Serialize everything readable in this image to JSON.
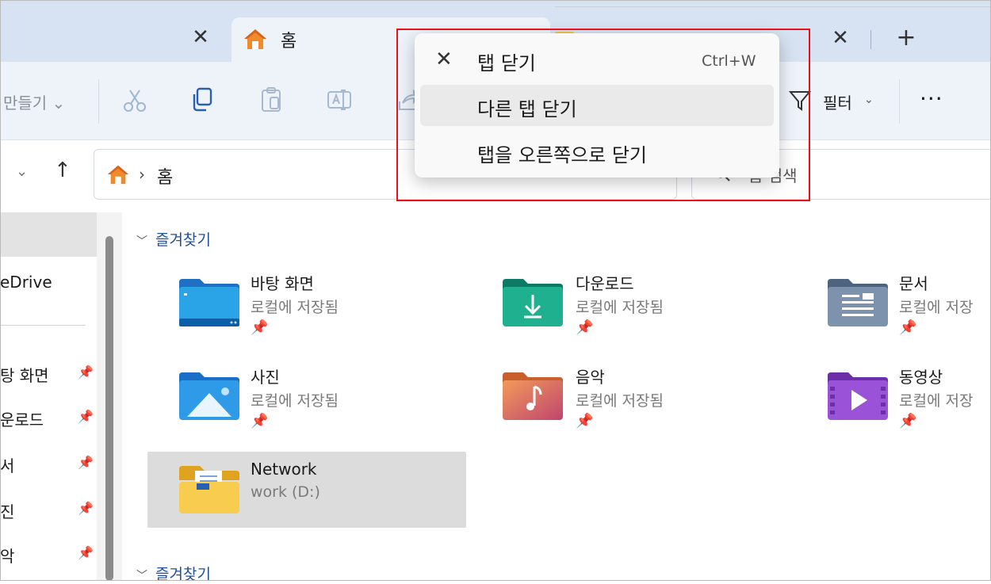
{
  "tabs": {
    "active_title": "홈",
    "new_tab": "+",
    "close_glyph": "✕"
  },
  "toolbar": {
    "new_label": "만들기 ⌄",
    "filter_label": "필터",
    "filter_chevron": "⌄",
    "more": "···"
  },
  "address": {
    "path_chevron": "›",
    "path_text": "홈",
    "search_placeholder": "홈 검색"
  },
  "nav": {
    "back": "⌄",
    "up": "↑",
    "refresh": "↻"
  },
  "sidebar": {
    "onedrive": "eDrive",
    "items": [
      {
        "label": "탕 화면"
      },
      {
        "label": "운로드"
      },
      {
        "label": "서"
      },
      {
        "label": "진"
      },
      {
        "label": "악"
      }
    ],
    "pin": "📌"
  },
  "main": {
    "section_title": "즐겨찾기",
    "section_title_2": "즐겨찾기",
    "folders": [
      {
        "name": "바탕 화면",
        "sub": "로컬에 저장됨"
      },
      {
        "name": "다운로드",
        "sub": "로컬에 저장됨"
      },
      {
        "name": "문서",
        "sub": "로컬에 저장"
      },
      {
        "name": "사진",
        "sub": "로컬에 저장됨"
      },
      {
        "name": "음악",
        "sub": "로컬에 저장됨"
      },
      {
        "name": "동영상",
        "sub": "로컬에 저장"
      },
      {
        "name": "Network",
        "sub": "work (D:)"
      }
    ]
  },
  "context_menu": {
    "items": [
      {
        "label": "탭 닫기",
        "shortcut": "Ctrl+W"
      },
      {
        "label": "다른 탭 닫기"
      },
      {
        "label": "탭을 오른쪽으로 닫기"
      }
    ]
  },
  "colors": {
    "accent_red": "#e8121c",
    "tab_strip": "#d7e3f2",
    "section_blue": "#1f4f9c"
  }
}
